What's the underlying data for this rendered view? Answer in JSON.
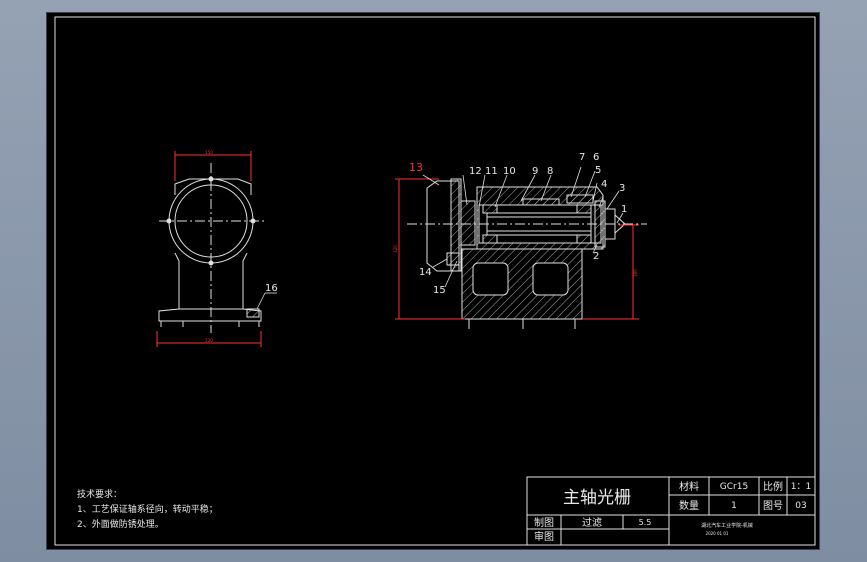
{
  "tech_requirements": {
    "heading": "技术要求：",
    "items": [
      "1、工艺保证轴系径向，转动平稳；",
      "2、外面做防锈处理。"
    ]
  },
  "title_block": {
    "part_name": "主轴光栅",
    "material_label": "材料",
    "material_value": "GCr15",
    "scale_label": "比例",
    "scale_value": "1：1",
    "quantity_label": "数量",
    "quantity_value": "1",
    "drawing_no_label": "图号",
    "drawing_no_value": "03",
    "drawn_label": "制图",
    "drawn_value": "过滤",
    "drawn_date": "5.5",
    "checked_label": "审图",
    "institution_line1": "湖北汽车工业学院-机械",
    "institution_line2": "2020 01 01"
  },
  "balloons": {
    "p1": "1",
    "p2": "2",
    "p3": "3",
    "p4": "4",
    "p5": "5",
    "p6": "6",
    "p7": "7",
    "p8": "8",
    "p9": "9",
    "p10": "10",
    "p11": "11",
    "p12": "12",
    "p13": "13",
    "p14": "14",
    "p15": "15",
    "p16": "16"
  },
  "dimensions": {
    "side_width_top": "150",
    "side_width_bottom": "220",
    "section_height": "320",
    "section_right": "300"
  }
}
